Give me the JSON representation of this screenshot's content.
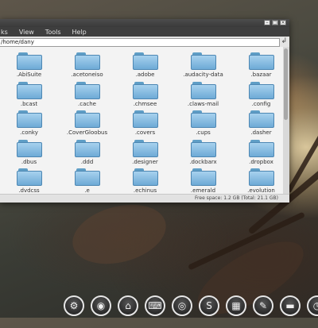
{
  "menubar": {
    "items": [
      "ks",
      "View",
      "Tools",
      "Help"
    ]
  },
  "location": {
    "path": "/home/dany"
  },
  "folders": [
    ".AbiSuite",
    ".acetoneiso",
    ".adobe",
    ".audacity-data",
    ".bazaar",
    ".bcast",
    ".cache",
    ".chmsee",
    ".claws-mail",
    ".config",
    ".conky",
    ".CoverGloobus",
    ".covers",
    ".cups",
    ".dasher",
    ".dbus",
    ".ddd",
    ".designer",
    ".dockbarx",
    ".dropbox",
    ".dvdcss",
    ".e",
    ".echinus",
    ".emerald",
    ".evolution"
  ],
  "statusbar": {
    "free_space": "Free space: 1.2 GB (Total: 21.1 GB)"
  },
  "dock": {
    "icons": [
      "gear-icon",
      "firefox-icon",
      "home-icon",
      "keyboard-icon",
      "network-icon",
      "skype-icon",
      "apps-grid-icon",
      "edit-icon",
      "folder-icon",
      "clock-icon"
    ]
  }
}
